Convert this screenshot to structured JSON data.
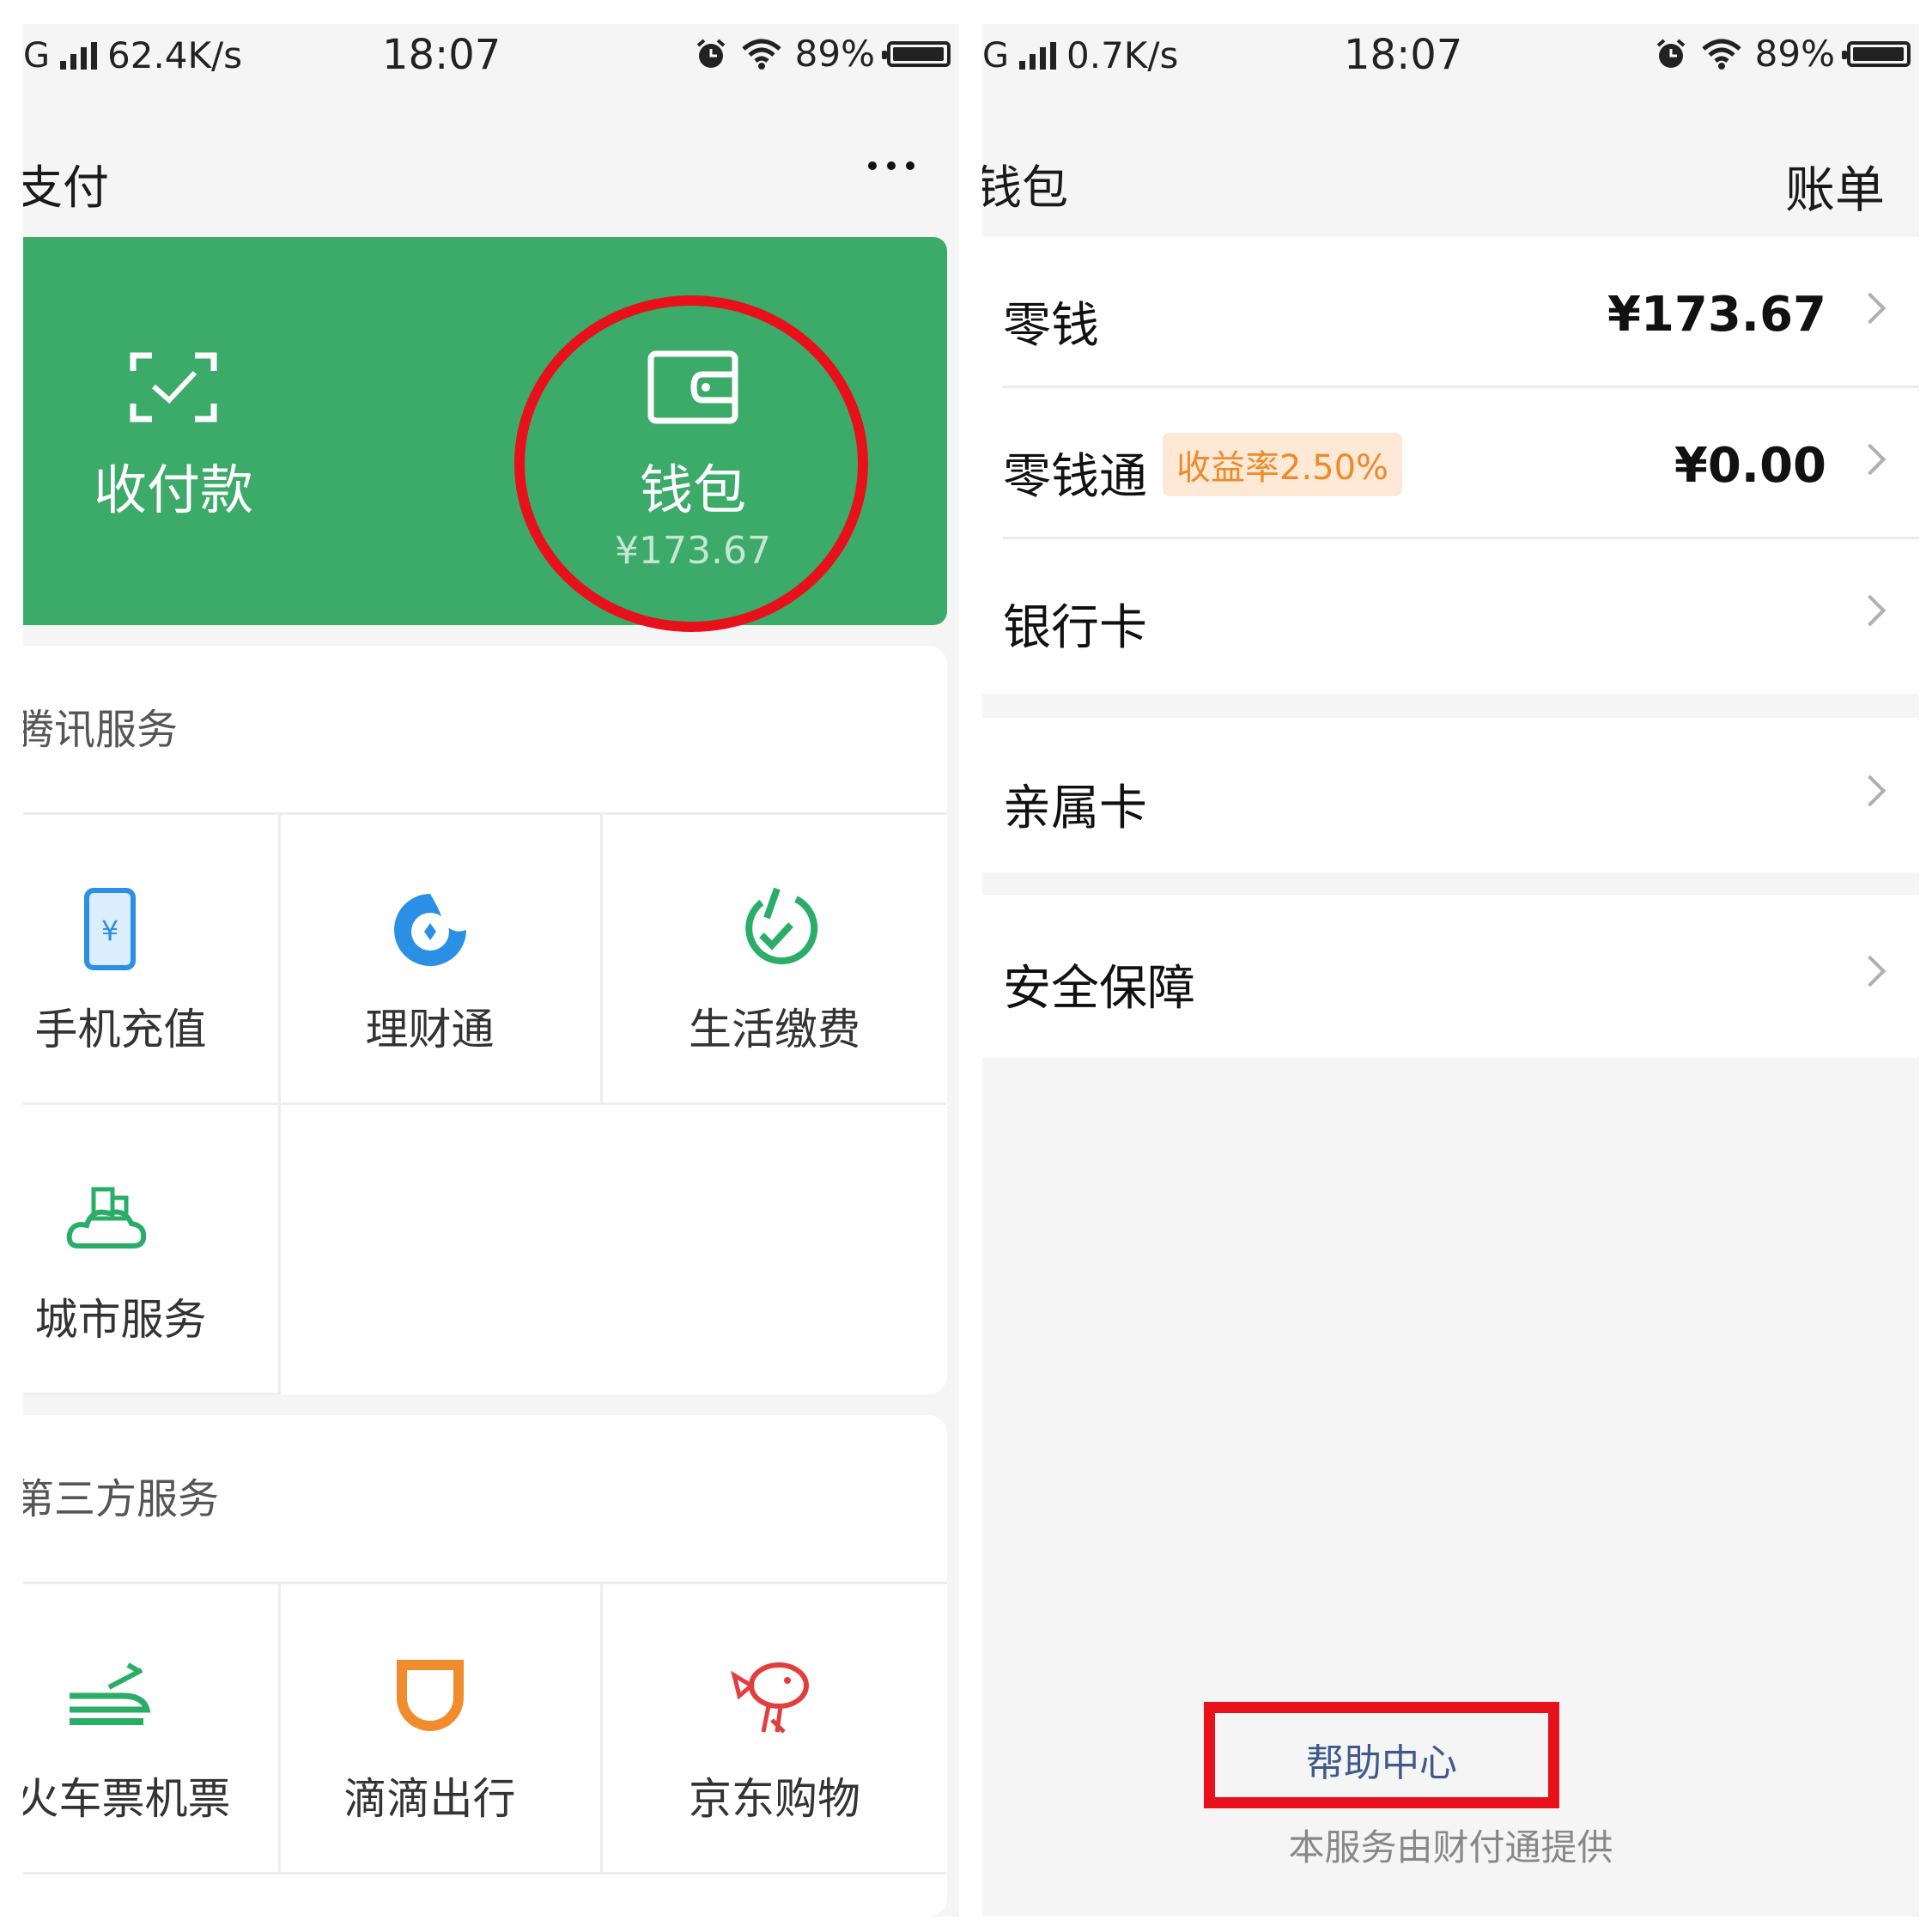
{
  "left": {
    "status": {
      "network": "62.4K/s",
      "time": "18:07",
      "battery": "89%"
    },
    "nav": {
      "title": "支付"
    },
    "card": {
      "collect_label": "收付款",
      "wallet_label": "钱包",
      "wallet_amount": "¥173.67"
    },
    "tencent_section": {
      "title": "腾讯服务",
      "items": [
        {
          "label": "手机充值",
          "icon": "phone-recharge-icon"
        },
        {
          "label": "理财通",
          "icon": "wealth-icon"
        },
        {
          "label": "生活缴费",
          "icon": "bill-payment-icon"
        },
        {
          "label": "城市服务",
          "icon": "city-service-icon"
        }
      ]
    },
    "third_section": {
      "title": "第三方服务",
      "items": [
        {
          "label": "火车票机票",
          "icon": "train-ticket-icon"
        },
        {
          "label": "滴滴出行",
          "icon": "didi-icon"
        },
        {
          "label": "京东购物",
          "icon": "jd-icon"
        }
      ]
    }
  },
  "right": {
    "status": {
      "network": "0.7K/s",
      "time": "18:07",
      "battery": "89%"
    },
    "nav": {
      "title": "钱包",
      "bill": "账单"
    },
    "rows": [
      {
        "name": "零钱",
        "amount": "¥173.67"
      },
      {
        "name": "零钱通",
        "badge": "收益率2.50%",
        "amount": "¥0.00"
      },
      {
        "name": "银行卡"
      },
      {
        "name": "亲属卡"
      },
      {
        "name": "安全保障"
      }
    ],
    "help": "帮助中心",
    "footer": "本服务由财付通提供"
  },
  "colors": {
    "green": "#3caa69",
    "highlight_red": "#e8101a",
    "badge_text": "#ee8a2b",
    "link": "#3f5a8a"
  }
}
